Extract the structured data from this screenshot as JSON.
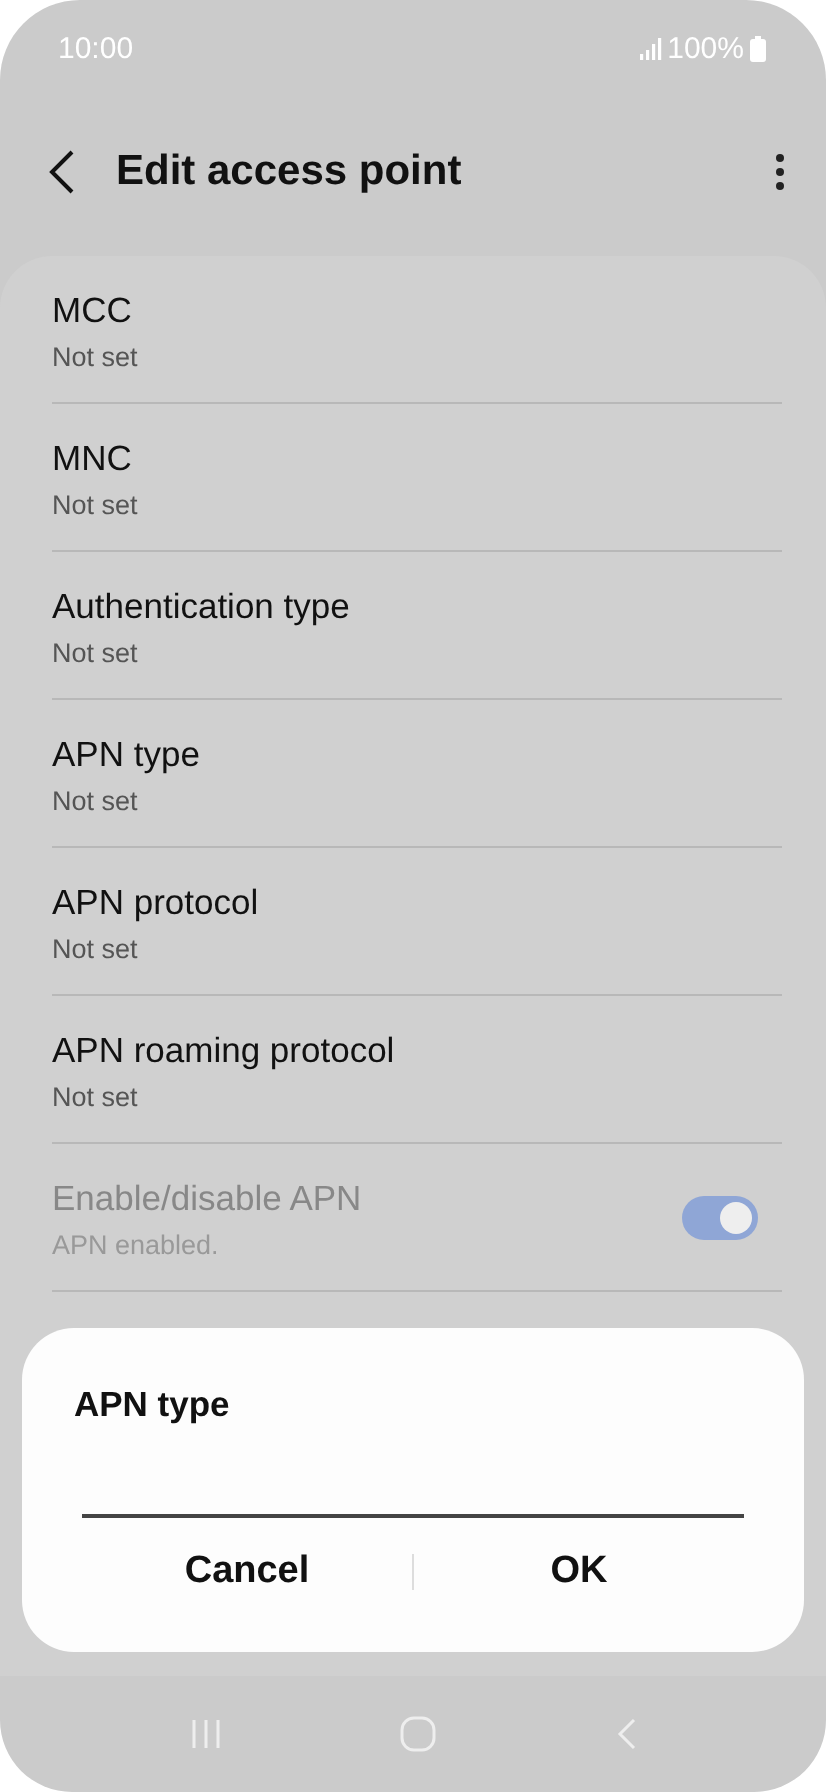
{
  "status_bar": {
    "time": "10:00",
    "battery": "100%"
  },
  "app_bar": {
    "title": "Edit access point"
  },
  "items": [
    {
      "kind": "text",
      "title": "MCC",
      "summary": "Not set",
      "disabled": false
    },
    {
      "kind": "text",
      "title": "MNC",
      "summary": "Not set",
      "disabled": false
    },
    {
      "kind": "text",
      "title": "Authentication type",
      "summary": "Not set",
      "disabled": false
    },
    {
      "kind": "text",
      "title": "APN type",
      "summary": "Not set",
      "disabled": false
    },
    {
      "kind": "text",
      "title": "APN protocol",
      "summary": "Not set",
      "disabled": false
    },
    {
      "kind": "text",
      "title": "APN roaming protocol",
      "summary": "Not set",
      "disabled": false
    },
    {
      "kind": "switch",
      "title": "Enable/disable APN",
      "summary": "APN enabled.",
      "disabled": true,
      "on": true
    }
  ],
  "dialog": {
    "title": "APN type",
    "buttons": [
      "Cancel",
      "OK"
    ]
  }
}
